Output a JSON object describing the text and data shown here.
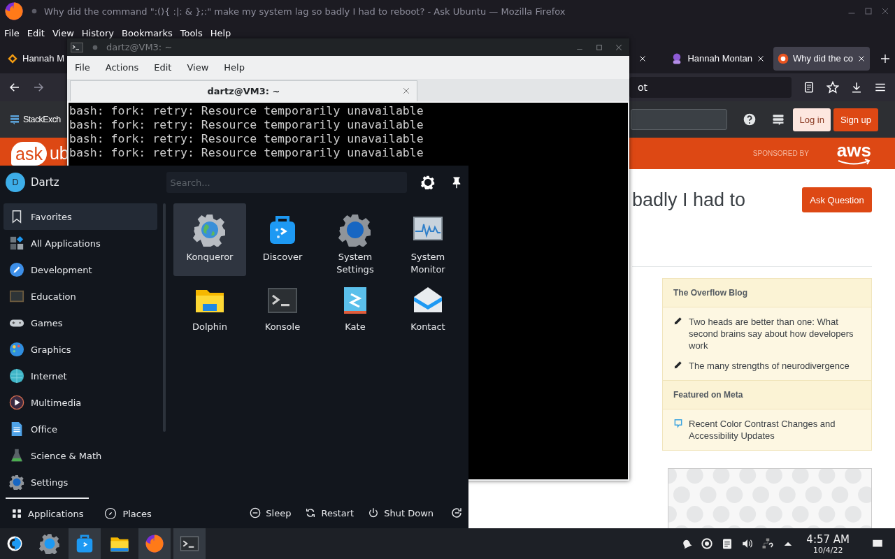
{
  "firefox": {
    "title": "Why did the command \":(){ :|: & };:\" make my system lag so badly I had to reboot? - Ask Ubuntu — Mozilla Firefox",
    "menu": [
      "File",
      "Edit",
      "View",
      "History",
      "Bookmarks",
      "Tools",
      "Help"
    ],
    "tabs": [
      {
        "label": "Hannah M",
        "selected": false
      },
      {
        "label": "Hannah Montan",
        "selected": false
      },
      {
        "label": "Why did the co",
        "selected": true
      }
    ],
    "url": "ot",
    "site": {
      "brand": "StackExch",
      "login": "Log in",
      "signup": "Sign up",
      "logo_bubble": "ask",
      "logo_rest": "ub",
      "sponsored": "SPONSORED BY",
      "sponsor": "aws",
      "question_title": "badly I had to",
      "ask_button": "Ask Question",
      "sidebar": [
        {
          "heading": "The Overflow Blog",
          "items": [
            {
              "kind": "blog",
              "text": "Two heads are better than one: What second brains say about how developers work"
            },
            {
              "kind": "blog",
              "text": "The many strengths of neurodivergence"
            }
          ]
        },
        {
          "heading": "Featured on Meta",
          "items": [
            {
              "kind": "meta",
              "text": "Recent Color Contrast Changes and Accessibility Updates"
            }
          ]
        }
      ]
    }
  },
  "konsole": {
    "title": "dartz@VM3: ~",
    "menu": [
      "File",
      "Actions",
      "Edit",
      "View",
      "Help"
    ],
    "tab": "dartz@VM3: ~",
    "lines": [
      "bash: fork: retry: Resource temporarily unavailable",
      "bash: fork: retry: Resource temporarily unavailable",
      "bash: fork: retry: Resource temporarily unavailable",
      "bash: fork: retry: Resource temporarily unavailable"
    ]
  },
  "launcher": {
    "user": "Dartz",
    "avatar": "D",
    "search_placeholder": "Search...",
    "categories": [
      {
        "label": "Favorites",
        "selected": true
      },
      {
        "label": "All Applications",
        "selected": false
      },
      {
        "label": "Development",
        "selected": false
      },
      {
        "label": "Education",
        "selected": false
      },
      {
        "label": "Games",
        "selected": false
      },
      {
        "label": "Graphics",
        "selected": false
      },
      {
        "label": "Internet",
        "selected": false
      },
      {
        "label": "Multimedia",
        "selected": false
      },
      {
        "label": "Office",
        "selected": false
      },
      {
        "label": "Science & Math",
        "selected": false
      },
      {
        "label": "Settings",
        "selected": false
      }
    ],
    "apps": [
      {
        "name": "Konqueror",
        "selected": true
      },
      {
        "name": "Discover",
        "selected": false
      },
      {
        "name": "System Settings",
        "selected": false
      },
      {
        "name": "System Monitor",
        "selected": false
      },
      {
        "name": "Dolphin",
        "selected": false
      },
      {
        "name": "Konsole",
        "selected": false
      },
      {
        "name": "Kate",
        "selected": false
      },
      {
        "name": "Kontact",
        "selected": false
      }
    ],
    "tabs": [
      {
        "label": "Applications",
        "selected": true
      },
      {
        "label": "Places",
        "selected": false
      }
    ],
    "actions": [
      "Sleep",
      "Restart",
      "Shut Down"
    ]
  },
  "taskbar": {
    "tasks": [
      {
        "running": false
      },
      {
        "running": false
      },
      {
        "running": true
      },
      {
        "running": false
      },
      {
        "running": true
      },
      {
        "running": true
      }
    ],
    "time": "4:57 AM",
    "date": "10/4/22"
  }
}
